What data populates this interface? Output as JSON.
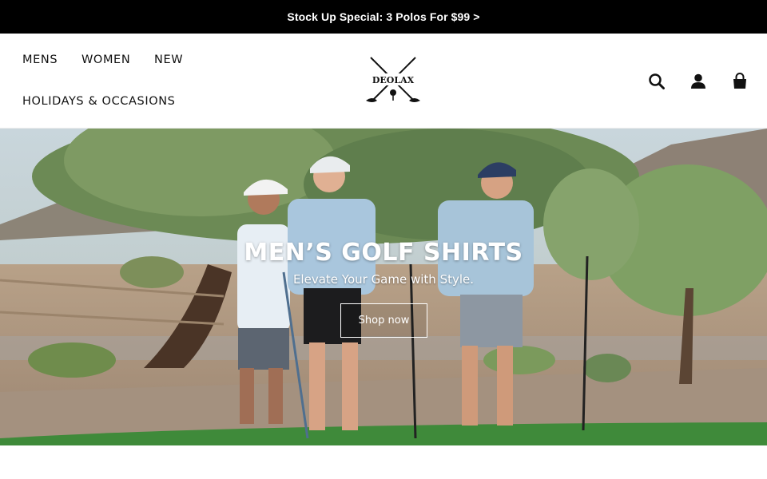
{
  "announcement": {
    "text": "Stock Up Special: 3 Polos For $99 >"
  },
  "header": {
    "nav": [
      {
        "label": "MENS"
      },
      {
        "label": "WOMEN"
      },
      {
        "label": "NEW"
      },
      {
        "label": "HOLIDAYS & OCCASIONS"
      }
    ],
    "logo": {
      "text": "DEOLAX"
    },
    "icons": [
      "search-icon",
      "account-icon",
      "cart-icon"
    ]
  },
  "hero": {
    "title": "MEN’S GOLF SHIRTS",
    "subtitle": "Elevate Your Game with Style.",
    "button_label": "Shop now"
  },
  "colors": {
    "announcement_bg": "#000000",
    "text": "#111111",
    "button_border": "#ffffff"
  }
}
